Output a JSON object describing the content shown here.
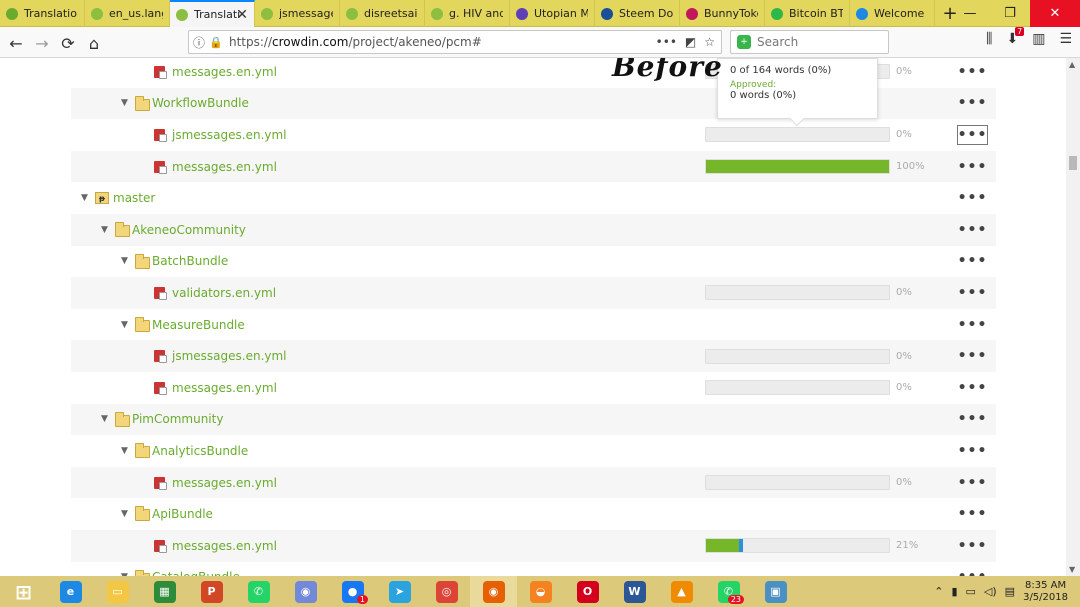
{
  "tabs": [
    {
      "label": "Translatio",
      "color": "#6aab2e"
    },
    {
      "label": "en_us.lang.p",
      "color": "#8cbf3f"
    },
    {
      "label": "Translati",
      "color": "#8cbf3f",
      "active": true
    },
    {
      "label": "jsmessages.e",
      "color": "#8cbf3f"
    },
    {
      "label": "disreetsaint'",
      "color": "#8cbf3f"
    },
    {
      "label": "g. HIV and A",
      "color": "#8cbf3f"
    },
    {
      "label": "Utopian Mo",
      "color": "#5e3fb5"
    },
    {
      "label": "Steem Dolla",
      "color": "#1a5099"
    },
    {
      "label": "BunnyToken",
      "color": "#c2185b"
    },
    {
      "label": "Bitcoin BTC",
      "color": "#2fb84a"
    },
    {
      "label": "Welcome | A",
      "color": "#1e88e5"
    }
  ],
  "window_controls": {
    "minimize": "—",
    "restore": "❐",
    "close": "✕"
  },
  "nav": {
    "back": "←",
    "forward": "→",
    "reload": "⟳",
    "home": "⌂",
    "url_prefix": "https://",
    "url_host": "crowdin.com",
    "url_path": "/project/akeneo/pcm#",
    "search_placeholder": "Search",
    "addon_badge": "7"
  },
  "overlay_text": "Before",
  "tooltip": {
    "line1": "0 of 164 words (0%)",
    "approved_label": "Approved:",
    "line2": "0 words (0%)"
  },
  "tree": [
    {
      "type": "file",
      "level": 3,
      "name": "messages.en.yml",
      "progress": 0,
      "pct": "0%",
      "alt": false
    },
    {
      "type": "folder",
      "level": 2,
      "name": "WorkflowBundle",
      "alt": true
    },
    {
      "type": "file",
      "level": 3,
      "name": "jsmessages.en.yml",
      "progress": 0,
      "pct": "0%",
      "alt": false,
      "boxed": true
    },
    {
      "type": "file",
      "level": 3,
      "name": "messages.en.yml",
      "progress": 1.0,
      "pct": "100%",
      "alt": true
    },
    {
      "type": "branch",
      "level": 0,
      "name": "master",
      "alt": false
    },
    {
      "type": "folder",
      "level": 1,
      "name": "AkeneoCommunity",
      "alt": true
    },
    {
      "type": "folder",
      "level": 2,
      "name": "BatchBundle",
      "alt": false
    },
    {
      "type": "file",
      "level": 3,
      "name": "validators.en.yml",
      "progress": 0,
      "pct": "0%",
      "alt": true
    },
    {
      "type": "folder",
      "level": 2,
      "name": "MeasureBundle",
      "alt": false
    },
    {
      "type": "file",
      "level": 3,
      "name": "jsmessages.en.yml",
      "progress": 0,
      "pct": "0%",
      "alt": true
    },
    {
      "type": "file",
      "level": 3,
      "name": "messages.en.yml",
      "progress": 0,
      "pct": "0%",
      "alt": false
    },
    {
      "type": "folder",
      "level": 1,
      "name": "PimCommunity",
      "alt": true
    },
    {
      "type": "folder",
      "level": 2,
      "name": "AnalyticsBundle",
      "alt": false
    },
    {
      "type": "file",
      "level": 3,
      "name": "messages.en.yml",
      "progress": 0,
      "pct": "0%",
      "alt": true
    },
    {
      "type": "folder",
      "level": 2,
      "name": "ApiBundle",
      "alt": false
    },
    {
      "type": "file",
      "level": 3,
      "name": "messages.en.yml",
      "progress": 0.18,
      "approved": 0.02,
      "pct": "21%",
      "alt": true
    },
    {
      "type": "folder",
      "level": 2,
      "name": "CatalogBundle",
      "alt": false
    }
  ],
  "more_label": "•••",
  "taskbar": [
    {
      "name": "start-button",
      "glyph": "⊞",
      "color": "#ffffff"
    },
    {
      "name": "ie-app",
      "glyph": "e",
      "color": "#1e88e5"
    },
    {
      "name": "explorer-app",
      "glyph": "▭",
      "color": "#f3c744"
    },
    {
      "name": "store-app",
      "glyph": "▦",
      "color": "#2e8b3a"
    },
    {
      "name": "powerpoint-app",
      "glyph": "P",
      "color": "#d24726"
    },
    {
      "name": "whatsapp-app",
      "glyph": "✆",
      "color": "#25d366"
    },
    {
      "name": "discord-app",
      "glyph": "◉",
      "color": "#7289da"
    },
    {
      "name": "messenger-app",
      "glyph": "●",
      "color": "#1877f2",
      "badge": "1"
    },
    {
      "name": "telegram-app",
      "glyph": "➤",
      "color": "#2aa3df"
    },
    {
      "name": "chrome-app",
      "glyph": "◎",
      "color": "#db4437"
    },
    {
      "name": "firefox-app",
      "glyph": "◉",
      "color": "#e66000",
      "hl": true
    },
    {
      "name": "uc-browser-app",
      "glyph": "◒",
      "color": "#f58220"
    },
    {
      "name": "opera-app",
      "glyph": "O",
      "color": "#d2001c"
    },
    {
      "name": "word-app",
      "glyph": "W",
      "color": "#2b5797"
    },
    {
      "name": "vlc-app",
      "glyph": "▲",
      "color": "#f08a00"
    },
    {
      "name": "whatsapp2-app",
      "glyph": "✆",
      "color": "#25d366",
      "badge": "23"
    },
    {
      "name": "photos-app",
      "glyph": "▣",
      "color": "#4a90c2"
    }
  ],
  "clock": {
    "time": "8:35 AM",
    "date": "3/5/2018"
  }
}
